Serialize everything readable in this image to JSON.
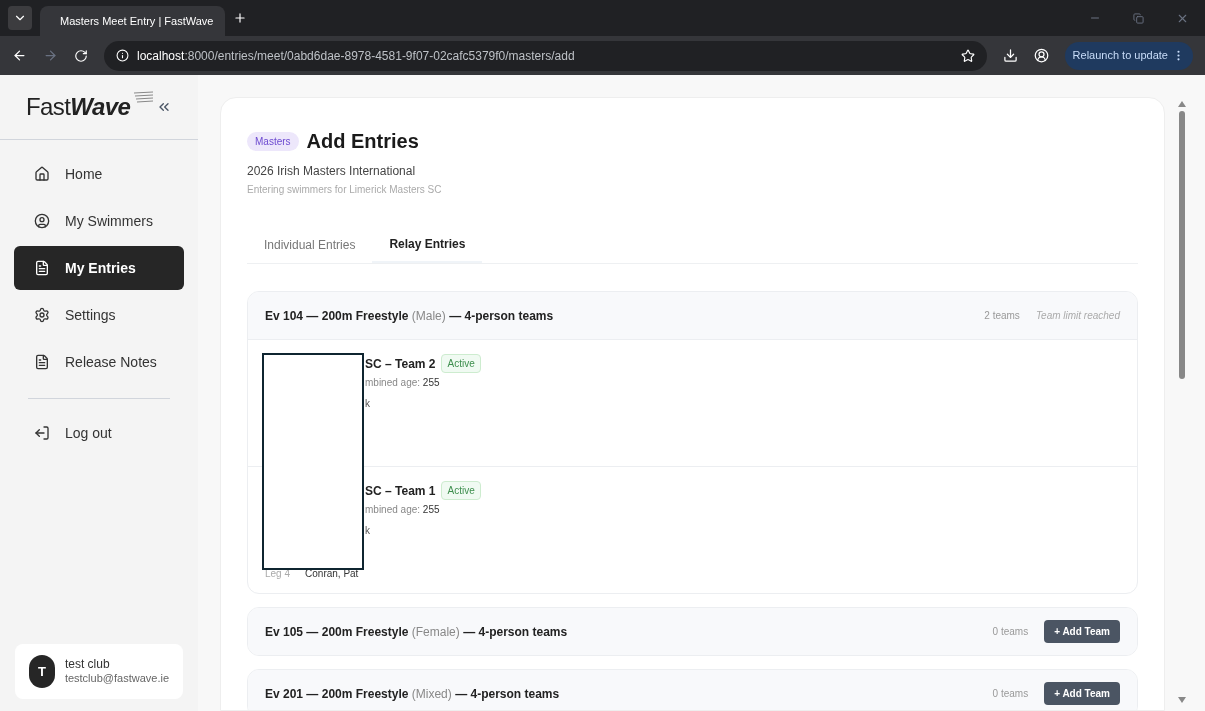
{
  "browser": {
    "tab_title": "Masters Meet Entry | FastWave",
    "url_host": "localhost",
    "url_path": ":8000/entries/meet/0abd6dae-8978-4581-9f07-02cafc5379f0/masters/add",
    "relaunch": "Relaunch to update"
  },
  "sidebar": {
    "logo_plain": "Fast",
    "logo_italic": "Wave",
    "items": [
      {
        "kind": "home",
        "label": "Home",
        "selected": false
      },
      {
        "kind": "people",
        "label": "My Swimmers",
        "selected": false
      },
      {
        "kind": "entries",
        "label": "My Entries",
        "selected": true
      },
      {
        "kind": "settings",
        "label": "Settings",
        "selected": false
      },
      {
        "kind": "notes",
        "label": "Release Notes",
        "selected": false
      }
    ],
    "logout": "Log out",
    "user": {
      "initial": "T",
      "name": "test club",
      "email": "testclub@fastwave.ie"
    }
  },
  "main": {
    "badge": "Masters",
    "title": "Add Entries",
    "subtitle": "2026 Irish Masters International",
    "note": "Entering swimmers for Limerick Masters SC",
    "tabs": [
      {
        "label": "Individual Entries",
        "selected": false
      },
      {
        "label": "Relay Entries",
        "selected": true
      }
    ],
    "events": [
      {
        "title": "Ev 104 — 200m Freestyle",
        "gender": "(Male)",
        "suffix": "— 4-person teams",
        "count": "2 teams",
        "limit_note": "Team limit reached",
        "teams": [
          {
            "name": "SC – Team 2",
            "status": "Active",
            "age_label": "mbined age:",
            "age": "255",
            "line": "k"
          },
          {
            "name": "SC – Team 1",
            "status": "Active",
            "age_label": "mbined age:",
            "age": "255",
            "line": "k",
            "leg_label": "Leg 4",
            "leg_swimmer": "Conran, Pat"
          }
        ]
      },
      {
        "title": "Ev 105 — 200m Freestyle",
        "gender": "(Female)",
        "suffix": "— 4-person teams",
        "count": "0 teams",
        "button": "+ Add Team"
      },
      {
        "title": "Ev 201 — 200m Freestyle",
        "gender": "(Mixed)",
        "suffix": "— 4-person teams",
        "count": "0 teams",
        "button": "+ Add Team"
      }
    ]
  }
}
